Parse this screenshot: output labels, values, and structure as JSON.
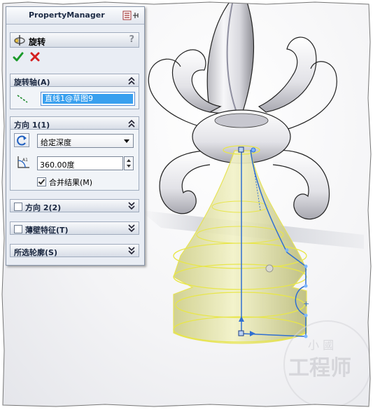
{
  "pm": {
    "title": "PropertyManager",
    "feature_name": "旋转",
    "help": "?",
    "sections": {
      "axis": {
        "label": "旋转轴(A)",
        "value": "直线1@草图9"
      },
      "dir1": {
        "label": "方向 1(1)",
        "type": "给定深度",
        "angle": "360.00度",
        "merge_label": "合并结果(M)",
        "merge_checked": true
      },
      "dir2": {
        "label": "方向 2(2)"
      },
      "thin": {
        "label": "薄壁特征(T)"
      },
      "contours": {
        "label": "所选轮廓(S)"
      }
    }
  },
  "watermark": {
    "line1": "小 國",
    "line2": "工程师"
  },
  "colors": {
    "accent": "#39a0ef",
    "sketch": "#2f6fd1",
    "preview": "#f0f078"
  }
}
